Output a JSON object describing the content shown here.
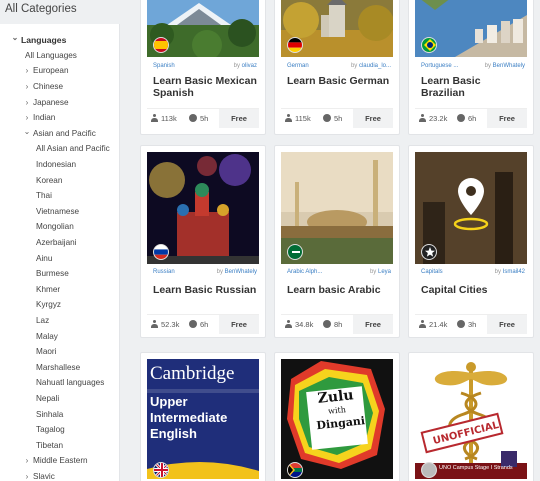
{
  "page": {
    "heading": "All Categories"
  },
  "sidebar": {
    "items": [
      {
        "label": "Languages",
        "level": 0,
        "chevron": "down"
      },
      {
        "label": "All Languages",
        "level": 1,
        "chevron": ""
      },
      {
        "label": "European",
        "level": 1,
        "chevron": "right"
      },
      {
        "label": "Chinese",
        "level": 1,
        "chevron": "right"
      },
      {
        "label": "Japanese",
        "level": 1,
        "chevron": "right"
      },
      {
        "label": "Indian",
        "level": 1,
        "chevron": "right"
      },
      {
        "label": "Asian and Pacific",
        "level": 1,
        "chevron": "down"
      },
      {
        "label": "All Asian and Pacific",
        "level": 2,
        "chevron": ""
      },
      {
        "label": "Indonesian",
        "level": 2,
        "chevron": ""
      },
      {
        "label": "Korean",
        "level": 2,
        "chevron": ""
      },
      {
        "label": "Thai",
        "level": 2,
        "chevron": ""
      },
      {
        "label": "Vietnamese",
        "level": 2,
        "chevron": ""
      },
      {
        "label": "Mongolian",
        "level": 2,
        "chevron": ""
      },
      {
        "label": "Azerbaijani",
        "level": 2,
        "chevron": ""
      },
      {
        "label": "Ainu",
        "level": 2,
        "chevron": ""
      },
      {
        "label": "Burmese",
        "level": 2,
        "chevron": ""
      },
      {
        "label": "Khmer",
        "level": 2,
        "chevron": ""
      },
      {
        "label": "Kyrgyz",
        "level": 2,
        "chevron": ""
      },
      {
        "label": "Laz",
        "level": 2,
        "chevron": ""
      },
      {
        "label": "Malay",
        "level": 2,
        "chevron": ""
      },
      {
        "label": "Maori",
        "level": 2,
        "chevron": ""
      },
      {
        "label": "Marshallese",
        "level": 2,
        "chevron": ""
      },
      {
        "label": "Nahuatl languages",
        "level": 2,
        "chevron": ""
      },
      {
        "label": "Nepali",
        "level": 2,
        "chevron": ""
      },
      {
        "label": "Sinhala",
        "level": 2,
        "chevron": ""
      },
      {
        "label": "Tagalog",
        "level": 2,
        "chevron": ""
      },
      {
        "label": "Tibetan",
        "level": 2,
        "chevron": ""
      },
      {
        "label": "Middle Eastern",
        "level": 1,
        "chevron": "right"
      },
      {
        "label": "Slavic",
        "level": 1,
        "chevron": "right"
      }
    ]
  },
  "cards": [
    {
      "lang": "Spanish",
      "by_prefix": "by",
      "author": "olivaz",
      "title": "Learn Basic Mexican Spanish",
      "users": "113k",
      "time": "5h",
      "price": "Free",
      "flag": "spain"
    },
    {
      "lang": "German",
      "by_prefix": "by",
      "author": "claudia_lo...",
      "title": "Learn Basic German",
      "users": "115k",
      "time": "5h",
      "price": "Free",
      "flag": "germany"
    },
    {
      "lang": "Portuguese ...",
      "by_prefix": "by",
      "author": "BenWhately",
      "title": "Learn Basic Brazilian",
      "users": "23.2k",
      "time": "6h",
      "price": "Free",
      "flag": "brazil"
    },
    {
      "lang": "Russian",
      "by_prefix": "by",
      "author": "BenWhately",
      "title": "Learn Basic Russian",
      "users": "52.3k",
      "time": "6h",
      "price": "Free",
      "flag": "russia"
    },
    {
      "lang": "Arabic Alph...",
      "by_prefix": "by",
      "author": "Leya",
      "title": "Learn basic Arabic",
      "users": "34.8k",
      "time": "8h",
      "price": "Free",
      "flag": "saudi"
    },
    {
      "lang": "Capitals",
      "by_prefix": "by",
      "author": "Ismail42",
      "title": "Capital Cities",
      "users": "21.4k",
      "time": "3h",
      "price": "Free",
      "flag": "star"
    },
    {
      "thumb_title": "Cambridge",
      "thumb_sub": [
        "Upper",
        "Intermediate",
        "English"
      ],
      "flag": "uk"
    },
    {
      "thumb_text": [
        "Zulu",
        "with",
        "Dingani"
      ],
      "flag": "southafrica"
    },
    {
      "thumb_stamp": "UNOFFICIAL",
      "thumb_caption": "UNO Campus Stage I Strands",
      "flag": "greydot"
    }
  ]
}
